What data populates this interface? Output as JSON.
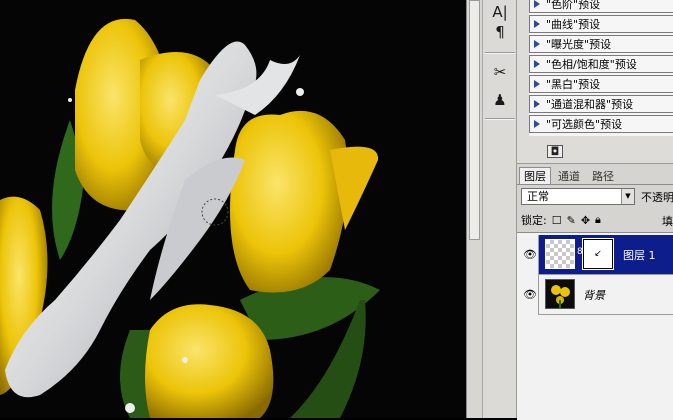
{
  "canvas": {
    "description_icon": "tulip-milk-splash-artwork"
  },
  "toolstrip": {
    "tools": [
      {
        "name": "character-panel-icon",
        "glyph": "A|"
      },
      {
        "name": "paragraph-icon",
        "glyph": "¶"
      },
      {
        "name": "brush-tools-icon",
        "glyph": "✂"
      },
      {
        "name": "clone-source-icon",
        "glyph": "♟"
      }
    ]
  },
  "adjustments": {
    "items": [
      "\"色阶\"预设",
      "\"曲线\"预设",
      "\"曝光度\"预设",
      "\"色相/饱和度\"预设",
      "\"黑白\"预设",
      "\"通道混和器\"预设",
      "\"可选颜色\"预设"
    ],
    "small_icon": "mask-icon"
  },
  "layers_panel": {
    "tabs": [
      "图层",
      "通道",
      "路径"
    ],
    "blend_mode": "正常",
    "opacity_label": "不透明",
    "lock_label": "锁定:",
    "fill_label": "填",
    "layers": [
      {
        "name": "图层 1",
        "selected": true,
        "has_mask": true
      },
      {
        "name": "背景",
        "selected": false,
        "has_mask": false
      }
    ]
  },
  "colors": {
    "selection": "#0d1e8c",
    "panel": "#dedcd8",
    "tulip": "#f2cf10",
    "milk": "#e4e6e8"
  }
}
